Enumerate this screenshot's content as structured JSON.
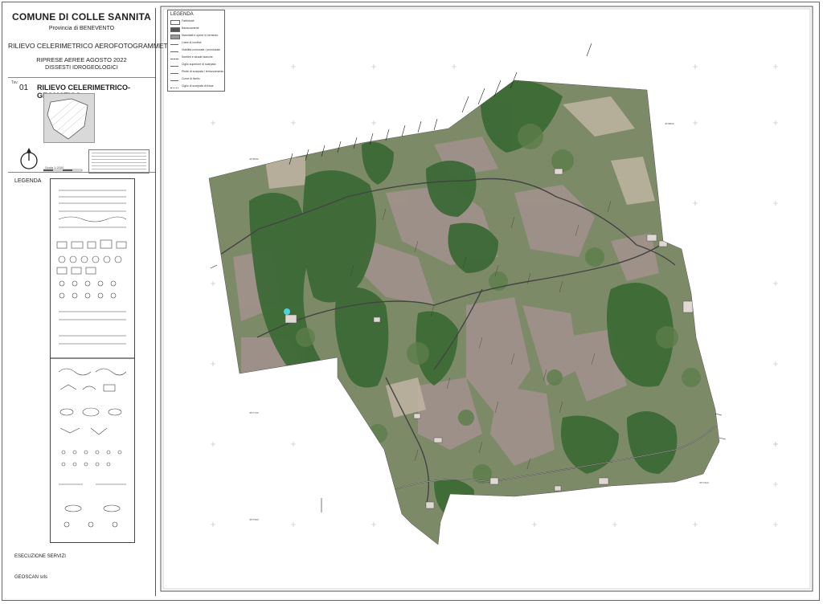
{
  "title_block": {
    "comune": "COMUNE DI COLLE SANNITA",
    "provincia": "Provincia di BENEVENTO",
    "rilievo": "RILIEVO CELERIMETRICO AEROFOTOGRAMMETRICO",
    "riprese": "RIPRESE AEREE AGOSTO 2022",
    "dissesti": "DISSESTI IDROGEOLOGICI",
    "tav_label": "Tav.",
    "tav_number": "01",
    "tav_title": "RILIEVO CELERIMETRICO-GEOMATICO",
    "scale": "Scala 1:2000",
    "legenda": "LEGENDA",
    "esecuzione": "ESECUZIONE SERVIZI",
    "geoscan": "GEOSCAN srls"
  },
  "map_legend": {
    "title": "LEGENDA",
    "items": [
      {
        "label": "Fabbricati",
        "color": "#ffffff"
      },
      {
        "label": "Baraccamenti",
        "color": "#555555"
      },
      {
        "label": "Manufatti e opere in cemento",
        "color": "#9a9a9a"
      },
      {
        "label": "Linee di confine",
        "color": "#ffffff"
      },
      {
        "label": "Viabilità comunale / provinciale",
        "color": "#ffffff"
      },
      {
        "label": "Sentieri e strade bianche",
        "color": "#ffffff"
      },
      {
        "label": "Ciglio superiore di scarpata",
        "color": "#ffffff"
      },
      {
        "label": "Piede di scarpata / terrazzamento",
        "color": "#ffffff"
      },
      {
        "label": "Curve di livello",
        "color": "#ffffff"
      },
      {
        "label": "Ciglio di scarpata di frana",
        "color": "#ffffff"
      }
    ]
  },
  "colors": {
    "ortho_base": "#7d8a68",
    "forest": "#3d6a36",
    "field": "#a1918c",
    "road": "#444444",
    "accent_cyan": "#4fd0df"
  }
}
